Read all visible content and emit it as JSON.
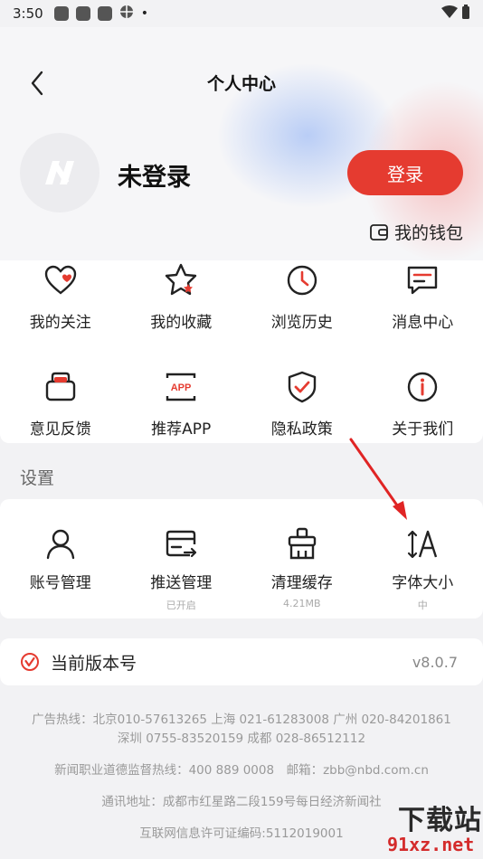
{
  "status": {
    "time": "3:50"
  },
  "nav": {
    "title": "个人中心"
  },
  "profile": {
    "name": "未登录",
    "login_label": "登录",
    "wallet_label": "我的钱包"
  },
  "grid": [
    {
      "label": "我的关注",
      "icon": "heart-icon"
    },
    {
      "label": "我的收藏",
      "icon": "star-icon"
    },
    {
      "label": "浏览历史",
      "icon": "clock-icon"
    },
    {
      "label": "消息中心",
      "icon": "message-icon"
    },
    {
      "label": "意见反馈",
      "icon": "feedback-icon"
    },
    {
      "label": "推荐APP",
      "icon": "app-icon"
    },
    {
      "label": "隐私政策",
      "icon": "shield-icon"
    },
    {
      "label": "关于我们",
      "icon": "info-icon"
    }
  ],
  "settings": {
    "title": "设置",
    "items": [
      {
        "label": "账号管理",
        "sub": "",
        "icon": "user-icon"
      },
      {
        "label": "推送管理",
        "sub": "已开启",
        "icon": "push-icon"
      },
      {
        "label": "清理缓存",
        "sub": "4.21MB",
        "icon": "broom-icon"
      },
      {
        "label": "字体大小",
        "sub": "中",
        "icon": "font-size-icon"
      }
    ]
  },
  "version": {
    "label": "当前版本号",
    "value": "v8.0.7"
  },
  "footer": {
    "hotline": "广告热线：北京010-57613265 上海 021-61283008 广州 020-84201861",
    "hotline2": "深圳 0755-83520159 成都 028-86512112",
    "ethics": "新闻职业道德监督热线：400 889 0008　邮箱：zbb@nbd.com.cn",
    "address": "通讯地址：成都市红星路二段159号每日经济新闻社",
    "license": "互联网信息许可证编码:5112019001"
  },
  "watermark": {
    "text": "下载站",
    "url": "91xz.net"
  },
  "colors": {
    "accent": "#e53b30",
    "background": "#f2f2f4"
  }
}
